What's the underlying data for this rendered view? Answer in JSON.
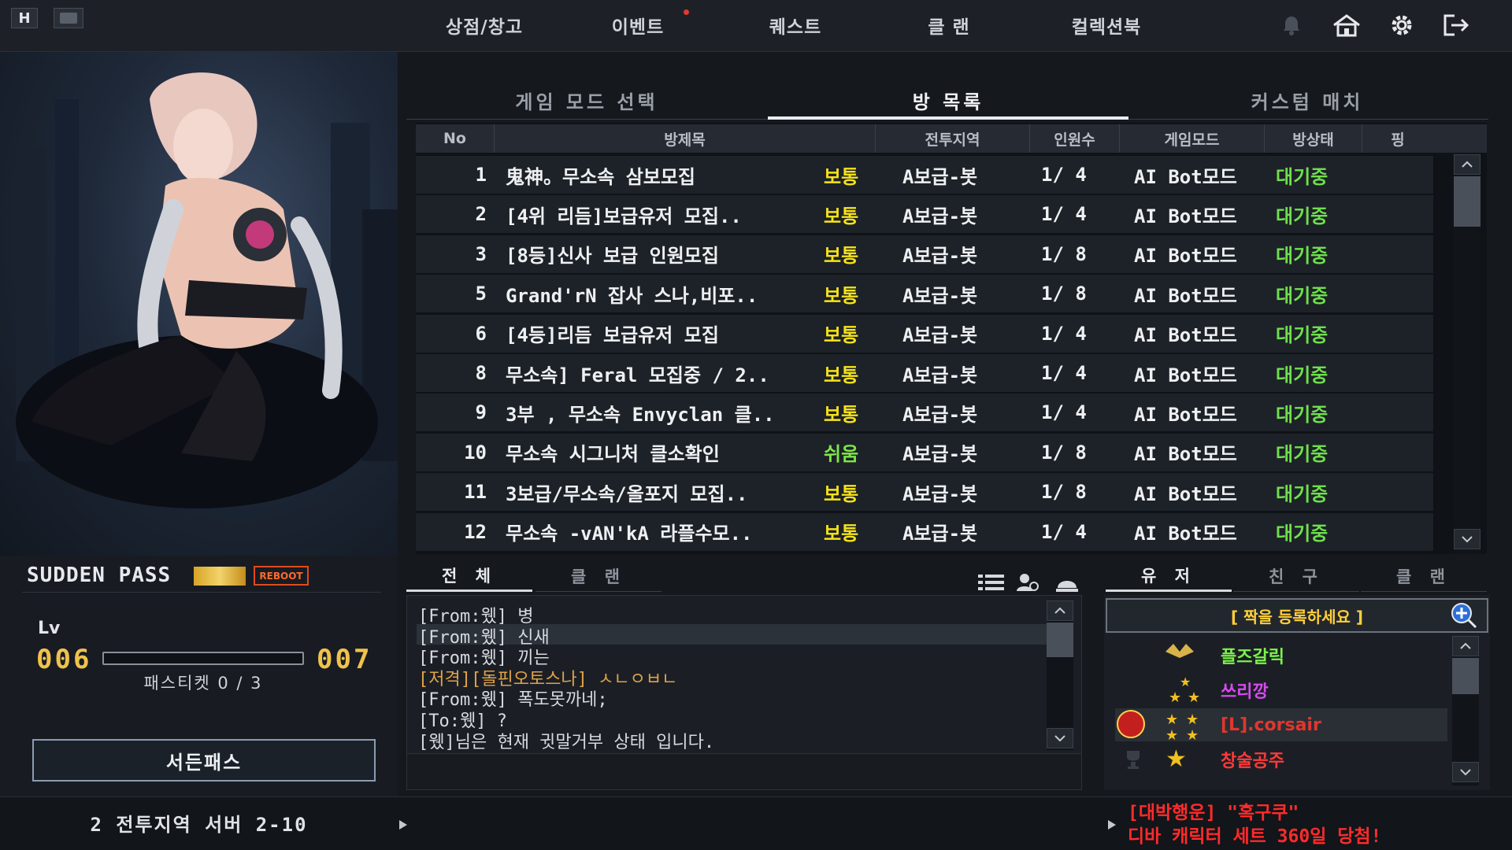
{
  "topbar": {
    "left_badge": "H",
    "menu": [
      "상점/창고",
      "이벤트",
      "퀘스트",
      "클 랜",
      "컬렉션북"
    ],
    "icons": [
      "bell-icon",
      "home-icon",
      "gear-icon",
      "exit-icon"
    ]
  },
  "main_tabs": [
    "게임 모드 선택",
    "방 목록",
    "커스텀 매치"
  ],
  "room_table": {
    "headers": [
      "No",
      "방제목",
      "전투지역",
      "인원수",
      "게임모드",
      "방상태",
      "핑"
    ],
    "rows": [
      {
        "no": "1",
        "title": "鬼神。무소속 삼보모집",
        "difficulty": "보통",
        "zone": "A보급-봇",
        "count": "1/ 4",
        "mode": "AI Bot모드",
        "state": "대기중"
      },
      {
        "no": "2",
        "title": "[4위 리듬]보급유저 모집..",
        "difficulty": "보통",
        "zone": "A보급-봇",
        "count": "1/ 4",
        "mode": "AI Bot모드",
        "state": "대기중"
      },
      {
        "no": "3",
        "title": "[8등]신사 보급 인원모집",
        "difficulty": "보통",
        "zone": "A보급-봇",
        "count": "1/ 8",
        "mode": "AI Bot모드",
        "state": "대기중"
      },
      {
        "no": "5",
        "title": "Grand'rN 잡사 스나,비포..",
        "difficulty": "보통",
        "zone": "A보급-봇",
        "count": "1/ 8",
        "mode": "AI Bot모드",
        "state": "대기중"
      },
      {
        "no": "6",
        "title": "[4등]리듬 보급유저 모집",
        "difficulty": "보통",
        "zone": "A보급-봇",
        "count": "1/ 4",
        "mode": "AI Bot모드",
        "state": "대기중"
      },
      {
        "no": "8",
        "title": "무소속] Feral 모집중 / 2..",
        "difficulty": "보통",
        "zone": "A보급-봇",
        "count": "1/ 4",
        "mode": "AI Bot모드",
        "state": "대기중"
      },
      {
        "no": "9",
        "title": "3부 , 무소속 Envyclan 클..",
        "difficulty": "보통",
        "zone": "A보급-봇",
        "count": "1/ 4",
        "mode": "AI Bot모드",
        "state": "대기중"
      },
      {
        "no": "10",
        "title": "무소속 시그니처 클소확인",
        "difficulty": "쉬움",
        "zone": "A보급-봇",
        "count": "1/ 8",
        "mode": "AI Bot모드",
        "state": "대기중"
      },
      {
        "no": "11",
        "title": "3보급/무소속/올포지 모집..",
        "difficulty": "보통",
        "zone": "A보급-봇",
        "count": "1/ 8",
        "mode": "AI Bot모드",
        "state": "대기중"
      },
      {
        "no": "12",
        "title": "무소속 -vAN'kA 라플수모..",
        "difficulty": "보통",
        "zone": "A보급-봇",
        "count": "1/ 4",
        "mode": "AI Bot모드",
        "state": "대기중"
      }
    ]
  },
  "pass": {
    "title": "SUDDEN PASS",
    "tag": "REBOOT",
    "lv_label": "Lv",
    "level_current": "006",
    "level_next": "007",
    "progress": 0.0,
    "ticket": "패스티켓 0 / 3",
    "button": "서든패스"
  },
  "chat": {
    "tabs": [
      "전 체",
      "클 랜"
    ],
    "lines": [
      {
        "text": "[From:웼] 병",
        "color": "#d6d9de"
      },
      {
        "text": "[From:웼] 신새",
        "color": "#d6d9de"
      },
      {
        "text": "[From:웼] 끼는",
        "color": "#d6d9de"
      },
      {
        "text": "[저격][돌핀오토스나] ㅅㄴㅇㅂㄴ",
        "color": "#e0a24a"
      },
      {
        "text": "[From:웼] 폭도못까네;",
        "color": "#d6d9de"
      },
      {
        "text": "[To:웼] ?",
        "color": "#d6d9de"
      },
      {
        "text": "[웼]님은 현재 귓말거부 상태 입니다.",
        "color": "#d6d9de"
      }
    ]
  },
  "users": {
    "tabs": [
      "유 저",
      "친 구",
      "클 랜"
    ],
    "pair_prompt": "[ 짝을 등록하세요 ]",
    "list": [
      {
        "name": "플즈갈릭",
        "color": "#7cf24a"
      },
      {
        "name": "쓰리깡",
        "color": "#d84af0"
      },
      {
        "name": "[L].corsair",
        "color": "#e0372e"
      },
      {
        "name": "창술공주",
        "color": "#ff3a3a"
      }
    ]
  },
  "server": "2 전투지역 서버 2-10",
  "ticker": {
    "line1": "[대박행운] \"혹구쿠\"",
    "line2": "디바 캐릭터 세트 360일 당첨!"
  }
}
